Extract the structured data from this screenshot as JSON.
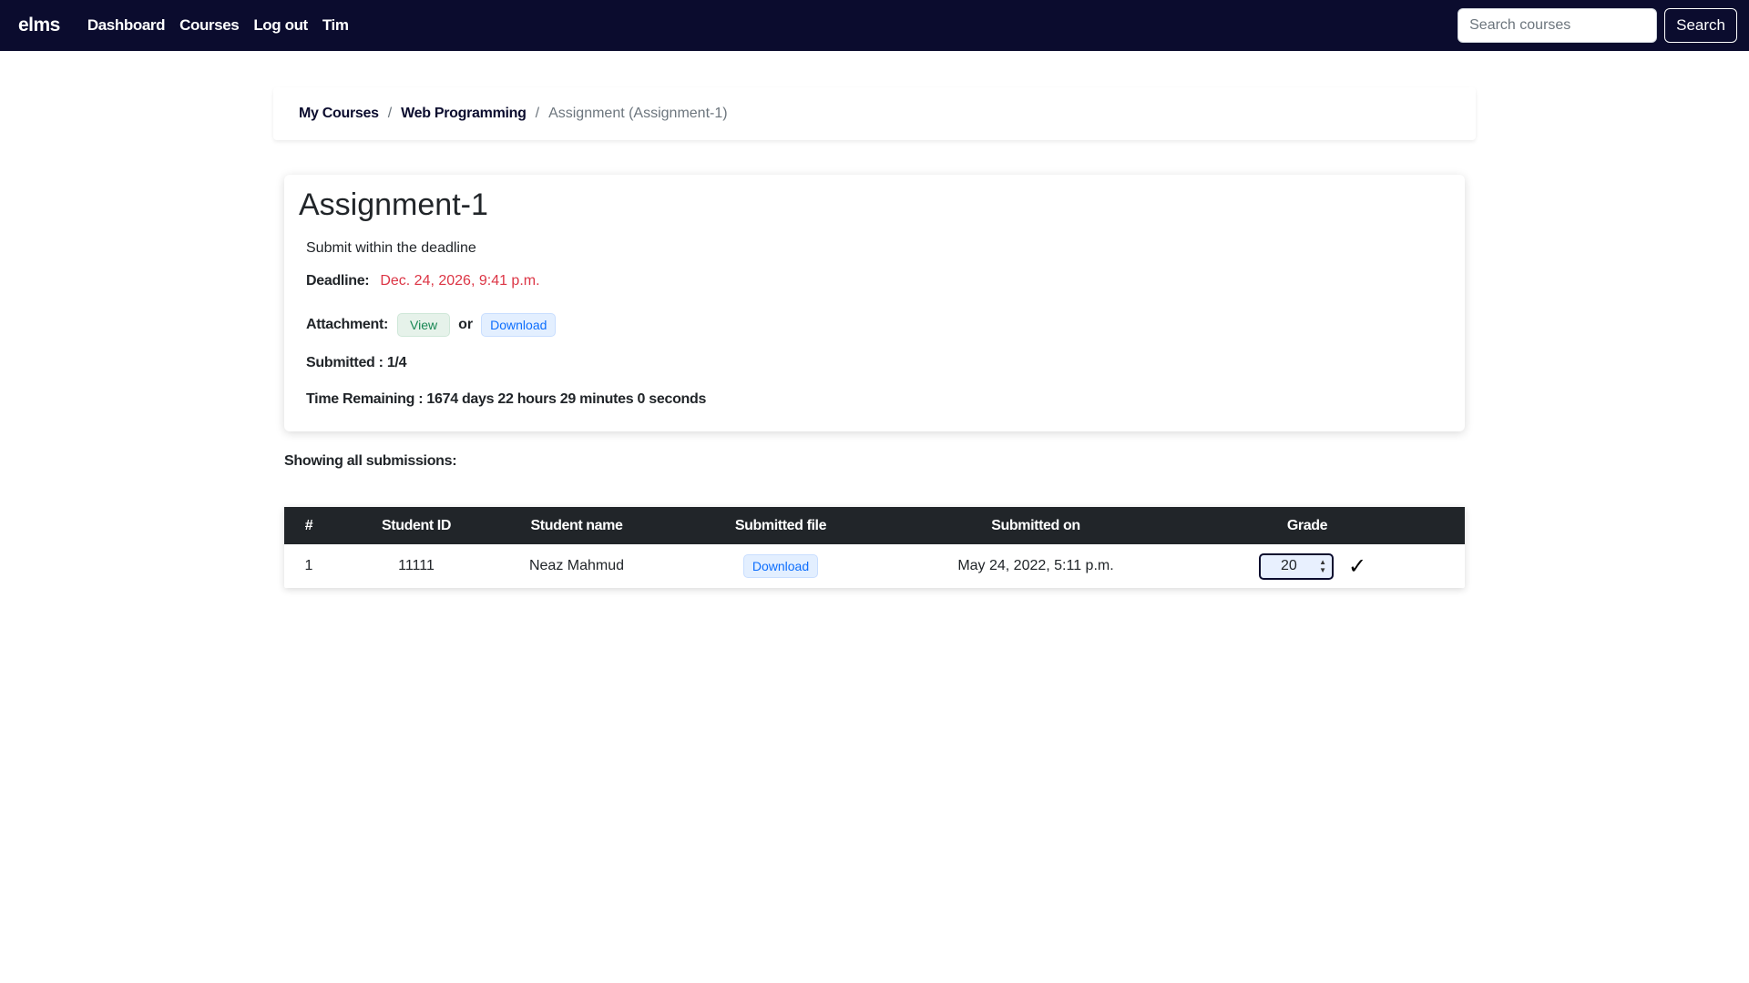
{
  "nav": {
    "brand": "elms",
    "links": [
      "Dashboard",
      "Courses",
      "Log out",
      "Tim"
    ],
    "search_placeholder": "Search courses",
    "search_button": "Search"
  },
  "breadcrumb": {
    "items": [
      "My Courses",
      "Web Programming"
    ],
    "current": "Assignment (Assignment-1)"
  },
  "assignment": {
    "title": "Assignment-1",
    "description": "Submit within the deadline",
    "deadline_label": "Deadline:",
    "deadline_value": "Dec. 24, 2026, 9:41 p.m.",
    "attachment_label": "Attachment:",
    "view_label": "View",
    "or_label": "or",
    "download_label": "Download",
    "submitted_text": "Submitted : 1/4",
    "time_remaining_text": "Time Remaining : 1674 days 22 hours 29 minutes 0 seconds"
  },
  "submissions": {
    "heading": "Showing all submissions:",
    "columns": [
      "#",
      "Student ID",
      "Student name",
      "Submitted file",
      "Submitted on",
      "Grade"
    ],
    "rows": [
      {
        "index": "1",
        "student_id": "11111",
        "student_name": "Neaz Mahmud",
        "file_label": "Download",
        "submitted_on": "May 24, 2022, 5:11 p.m.",
        "grade": "20",
        "save_icon": "✓"
      }
    ]
  },
  "colors": {
    "navbar_bg": "#0b0c2e",
    "deadline_red": "#dc3545",
    "table_header_bg": "#212529"
  }
}
